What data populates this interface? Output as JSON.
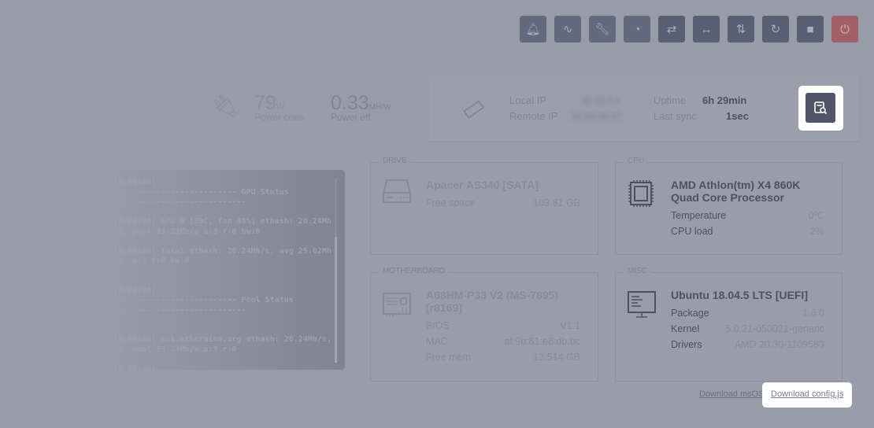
{
  "toolbar": [
    {
      "name": "bell-icon",
      "glyph": "🔔︎"
    },
    {
      "name": "activity-icon",
      "glyph": "∿"
    },
    {
      "name": "wrench-icon",
      "glyph": "🔧︎"
    },
    {
      "name": "gauge-icon",
      "glyph": "◔"
    },
    {
      "name": "swap-grid-icon",
      "glyph": "⇄"
    },
    {
      "name": "arrows-horizontal-icon",
      "glyph": "↔"
    },
    {
      "name": "sync-icon",
      "glyph": "⇅"
    },
    {
      "name": "restart-icon",
      "glyph": "↻"
    },
    {
      "name": "stop-icon",
      "glyph": "■"
    },
    {
      "name": "power-icon",
      "glyph": "⏻"
    }
  ],
  "power": {
    "consumption": "79",
    "consumption_unit": "W",
    "consumption_label": "Power cons.",
    "efficiency": "0.33",
    "efficiency_unit": "MH/W",
    "efficiency_label": "Power eff."
  },
  "network": {
    "local_ip_label": "Local IP",
    "local_ip": "10.10.0.2",
    "remote_ip_label": "Remote IP",
    "remote_ip": "91.00.00.47",
    "uptime_label": "Uptime",
    "uptime": "6h 29min",
    "last_sync_label": "Last sync",
    "last_sync": "1sec"
  },
  "terminal": {
    "lines": [
      "[0:00:26]",
      "  ------------------------ GPU Status",
      "  --------------------------",
      "",
      "[0:00:26] GPU 0 [39C, fan 40%] ethash: 26.24Mh",
      "/s, pool 33.33Mh/s a:3 r:0 hw:0",
      "",
      "[0:00:26] Total ethash: 26.24Mh/s, avg 25.02Mh",
      "/s, a:3 r:0 hw:0",
      "",
      "",
      "[0:00:26]",
      "  ------------------------ Pool Status",
      "  --------------------------",
      "",
      "",
      "[0:00:26] eu1.ethermine.org ethash: 26.24Mh/s,",
      "/s, pool 33.33Mh/s a:3 r:0",
      "",
      "[0:00:26]",
      "  ----------------------------------------"
    ]
  },
  "drive": {
    "legend": "DRIVE",
    "title": "Apacer AS340 [SATA]",
    "rows": [
      {
        "label": "Free space",
        "value": "103.81 GB"
      }
    ]
  },
  "cpu": {
    "legend": "CPU",
    "title": "AMD Athlon(tm) X4 860K Quad Core Processor",
    "rows": [
      {
        "label": "Temperature",
        "value": "0ºC"
      },
      {
        "label": "CPU load",
        "value": "2%"
      }
    ]
  },
  "motherboard": {
    "legend": "MOTHERBOARD",
    "title": "A68HM-P33 V2 (MS-7895) [r8169]",
    "rows": [
      {
        "label": "BIOS",
        "value": "V1.1"
      },
      {
        "label": "MAC",
        "value": "af:9b:81:e8:db:bc"
      },
      {
        "label": "Free mem",
        "value": "13.514 GB"
      }
    ]
  },
  "misc": {
    "legend": "MISC",
    "title": "Ubuntu 18.04.5 LTS [UEFI]",
    "rows": [
      {
        "label": "Package",
        "value": "1.6.0"
      },
      {
        "label": "Kernel",
        "value": "5.0.21-050021-generic"
      },
      {
        "label": "Drivers",
        "value": "AMD 20.30-1109583"
      }
    ]
  },
  "links": {
    "download_msos": "Download msOS",
    "download_config": "Download config.js"
  },
  "colors": {
    "overlay": "#979ca8",
    "button": "#5a6073",
    "power_button": "#a06068",
    "spotlight": "#ffffff"
  }
}
